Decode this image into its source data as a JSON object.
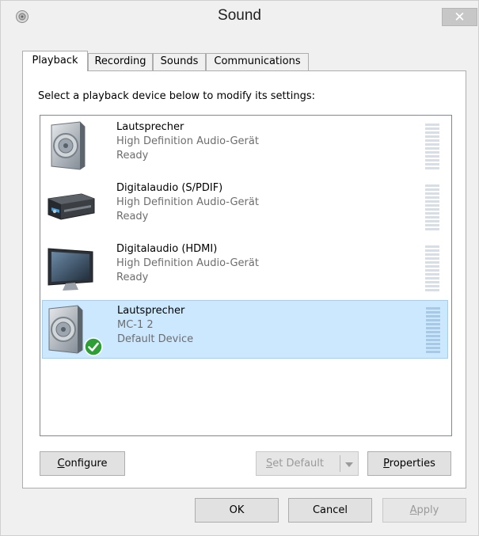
{
  "window": {
    "title": "Sound"
  },
  "tabs": [
    {
      "label": "Playback"
    },
    {
      "label": "Recording"
    },
    {
      "label": "Sounds"
    },
    {
      "label": "Communications"
    }
  ],
  "instruction": "Select a playback device below to modify its settings:",
  "devices": [
    {
      "name": "Lautsprecher",
      "description": "High Definition Audio-Gerät",
      "status": "Ready",
      "icon": "speaker-icon"
    },
    {
      "name": "Digitalaudio (S/PDIF)",
      "description": "High Definition Audio-Gerät",
      "status": "Ready",
      "icon": "receiver-icon"
    },
    {
      "name": "Digitalaudio (HDMI)",
      "description": "High Definition Audio-Gerät",
      "status": "Ready",
      "icon": "monitor-icon"
    },
    {
      "name": "Lautsprecher",
      "description": "MC-1 2",
      "status": "Default Device",
      "icon": "speaker-icon",
      "badge": "check-icon"
    }
  ],
  "buttons": {
    "configure_prefix": "C",
    "configure_rest": "onfigure",
    "setdefault_prefix": "S",
    "setdefault_rest": "et Default",
    "properties_prefix": "P",
    "properties_rest": "roperties",
    "ok": "OK",
    "cancel": "Cancel",
    "apply_prefix": "A",
    "apply_rest": "pply"
  },
  "colors": {
    "selection_bg": "#cce8ff",
    "selection_border": "#99d1ff",
    "default_check": "#2e9e36"
  }
}
